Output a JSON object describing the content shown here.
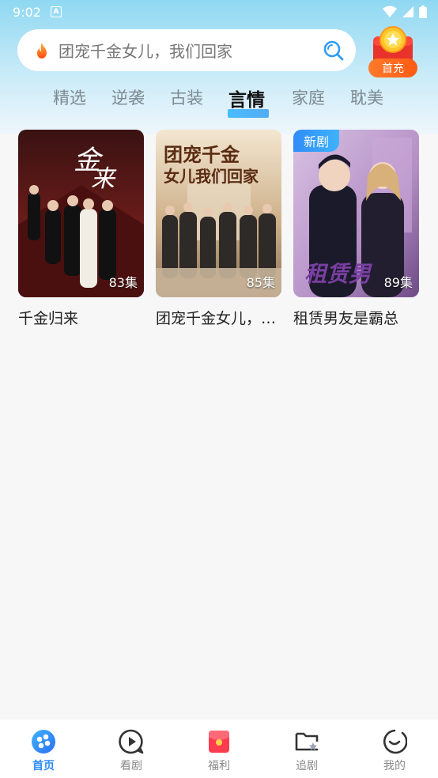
{
  "status_bar": {
    "time": "9:02"
  },
  "search": {
    "placeholder": "团宠千金女儿，我们回家"
  },
  "recharge": {
    "label": "首充"
  },
  "tabs": [
    {
      "label": "精选"
    },
    {
      "label": "逆袭"
    },
    {
      "label": "古装"
    },
    {
      "label": "言情",
      "active": true
    },
    {
      "label": "家庭"
    },
    {
      "label": "耽美"
    }
  ],
  "dramas": [
    {
      "title": "千金归来",
      "episodes": "83集",
      "badge": "",
      "poster_text": "千金归来"
    },
    {
      "title": "团宠千金女儿，我们回家",
      "episodes": "85集",
      "badge": "",
      "poster_text": "团宠千金女儿我们回家"
    },
    {
      "title": "租赁男友是霸总",
      "episodes": "89集",
      "badge": "新剧",
      "poster_text": "租赁男友"
    }
  ],
  "bottom_nav": [
    {
      "label": "首页",
      "active": true
    },
    {
      "label": "看剧"
    },
    {
      "label": "福利"
    },
    {
      "label": "追剧"
    },
    {
      "label": "我的"
    }
  ],
  "colors": {
    "accent": "#2f8cf6",
    "recharge": "#ff5b14"
  }
}
